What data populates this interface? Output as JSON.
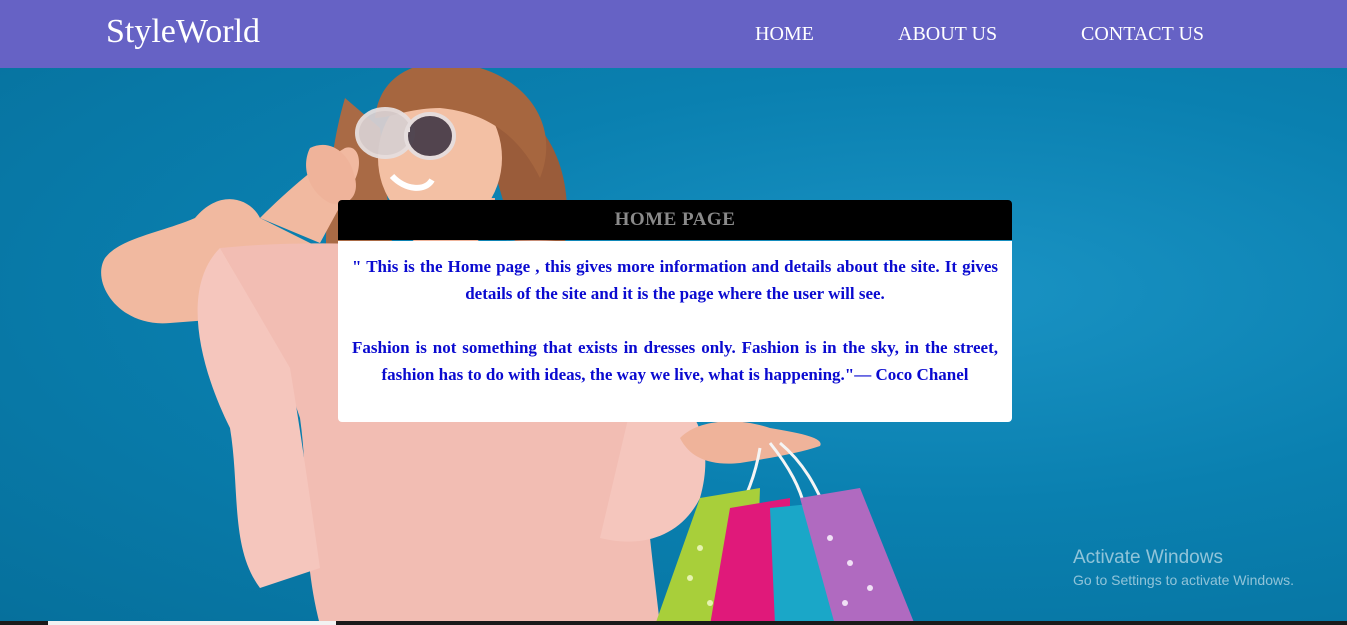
{
  "navbar": {
    "brand": "StyleWorld",
    "links": [
      {
        "label": "HOME"
      },
      {
        "label": "ABOUT US"
      },
      {
        "label": "CONTACT US"
      }
    ],
    "background": "#6662c5"
  },
  "card": {
    "title": "HOME PAGE",
    "paragraph1": "\" This is the Home page , this gives more information and details about the site. It gives details of the site and it is the page where the user will see.",
    "paragraph2": "Fashion is not something that exists in dresses only. Fashion is in the sky, in the street, fashion has to do with ideas, the way we live, what is happening.\"— Coco Chanel",
    "text_color": "#0a0ad0"
  },
  "watermark": {
    "title": "Activate Windows",
    "subtitle": "Go to Settings to activate Windows."
  },
  "hero": {
    "background_color": "#0a80b0",
    "icons": [
      "woman-figure",
      "sunglasses-icon",
      "shopping-bags-icon"
    ]
  }
}
